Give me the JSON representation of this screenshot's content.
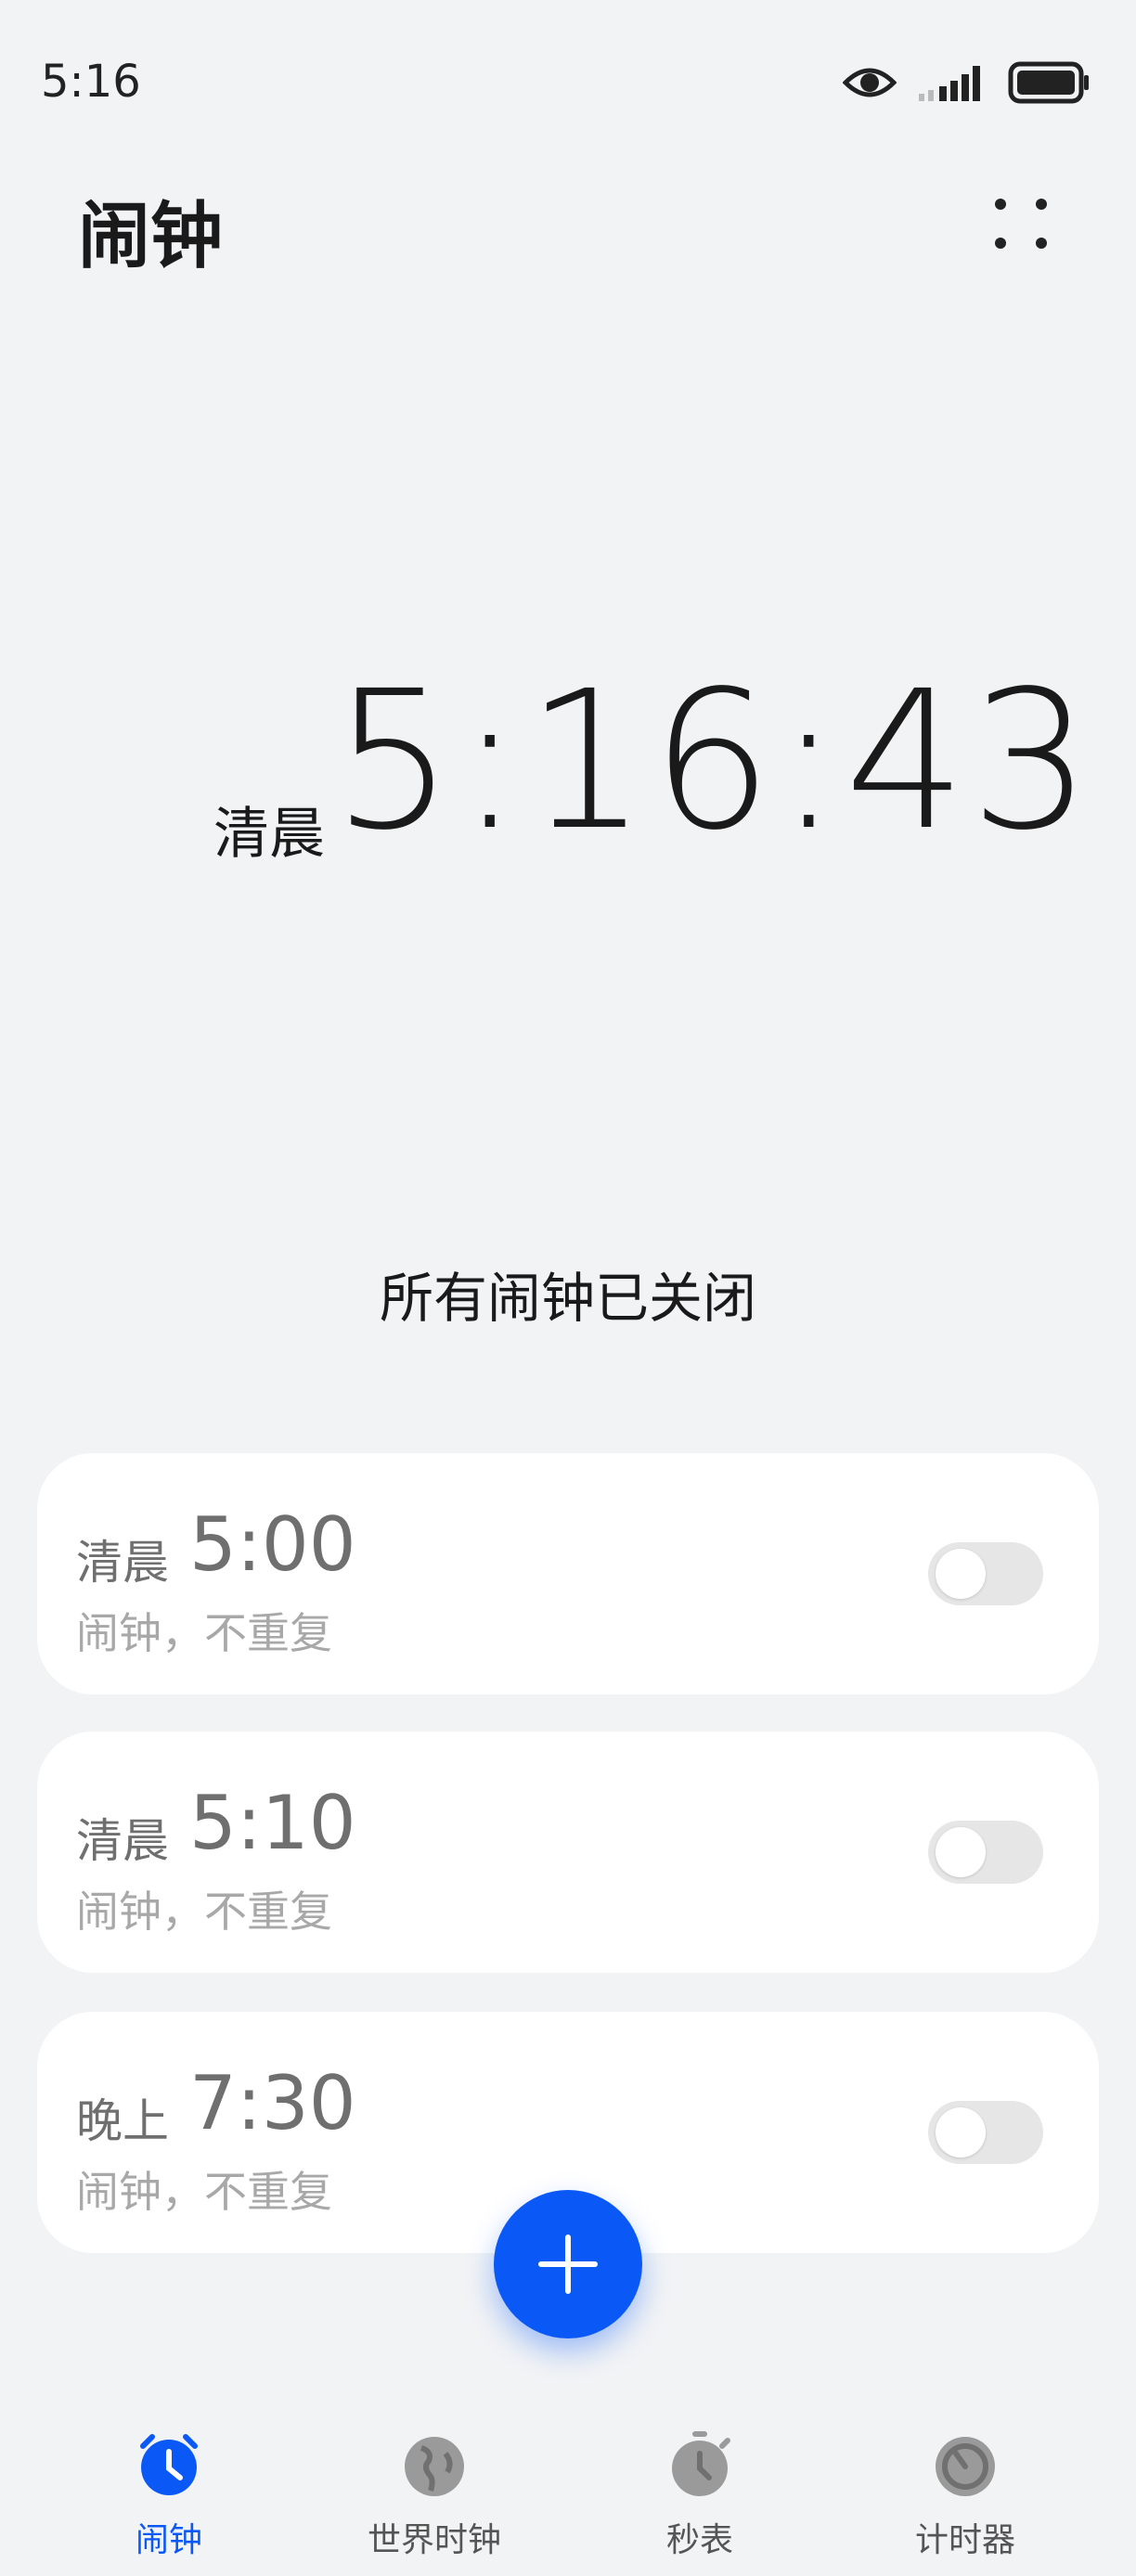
{
  "status_bar": {
    "time": "5:16",
    "icons": [
      "eye-icon",
      "signal-icon",
      "battery-icon"
    ]
  },
  "header": {
    "title": "闹钟",
    "more_icon": "more-dots-icon"
  },
  "clock": {
    "period": "清晨",
    "time": "5:16:43"
  },
  "status_message": "所有闹钟已关闭",
  "alarms": [
    {
      "period": "清晨",
      "time": "5:00",
      "subtitle": "闹钟，不重复",
      "enabled": false
    },
    {
      "period": "清晨",
      "time": "5:10",
      "subtitle": "闹钟，不重复",
      "enabled": false
    },
    {
      "period": "晚上",
      "time": "7:30",
      "subtitle": "闹钟，不重复",
      "enabled": false
    }
  ],
  "fab": {
    "icon": "plus-icon"
  },
  "bottom_nav": {
    "items": [
      {
        "label": "闹钟",
        "icon": "alarm-clock-icon",
        "active": true
      },
      {
        "label": "世界时钟",
        "icon": "globe-icon",
        "active": false
      },
      {
        "label": "秒表",
        "icon": "stopwatch-icon",
        "active": false
      },
      {
        "label": "计时器",
        "icon": "timer-icon",
        "active": false
      }
    ]
  },
  "colors": {
    "accent": "#0a59f7",
    "background": "#f1f3f5",
    "card": "#ffffff",
    "muted_text": "#6f6f6f",
    "inactive_icon": "#9a9a9a"
  }
}
